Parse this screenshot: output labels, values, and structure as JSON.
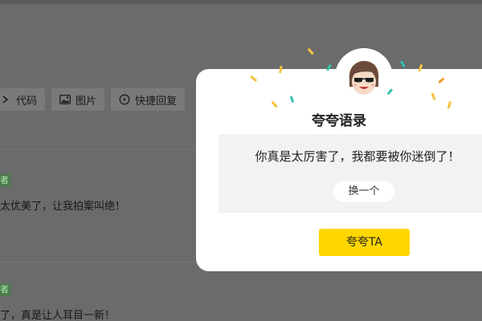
{
  "toolbar": {
    "buttons": [
      {
        "label": "代码",
        "icon": "code-icon"
      },
      {
        "label": "图片",
        "icon": "image-icon"
      },
      {
        "label": "快捷回复",
        "icon": "quick-reply-icon"
      }
    ]
  },
  "comments": [
    {
      "badge": "者",
      "text": "太优美了，让我拍案叫绝！"
    },
    {
      "badge": "者",
      "text": "了，真是让人耳目一新！"
    }
  ],
  "modal": {
    "title": "夸夸语录",
    "praise_text": "你真是太厉害了，我都要被你迷倒了！",
    "swap_label": "换一个",
    "praise_button_label": "夸夸TA",
    "accent_color": "#ffd700"
  }
}
